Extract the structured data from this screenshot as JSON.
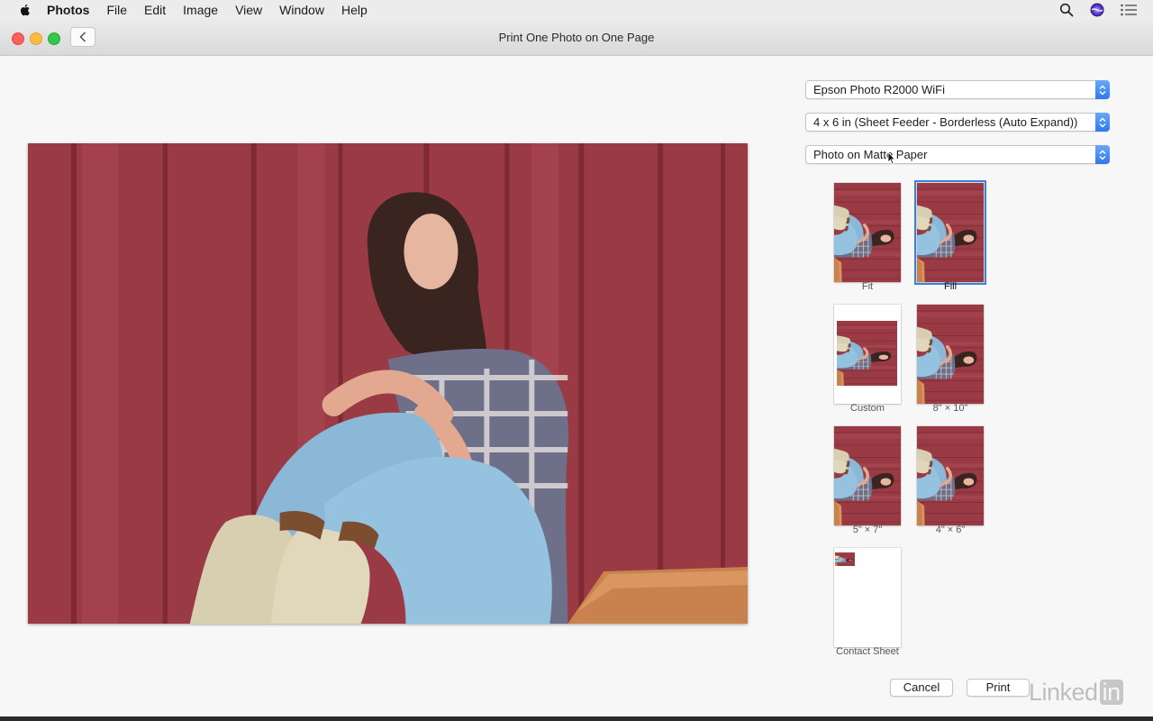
{
  "menubar": {
    "app_name": "Photos",
    "items": [
      "File",
      "Edit",
      "Image",
      "View",
      "Window",
      "Help"
    ],
    "icons": [
      "apple-icon",
      "spotlight-search-icon",
      "siri-icon",
      "notification-center-icon"
    ]
  },
  "window": {
    "title": "Print One Photo on One Page"
  },
  "print_options": {
    "printer": "Epson Photo R2000 WiFi",
    "paper_size": "4 x 6 in (Sheet Feeder - Borderless (Auto Expand))",
    "paper_type": "Photo on Matte Paper"
  },
  "layouts": [
    {
      "label": "Fit",
      "selected": false
    },
    {
      "label": "Fill",
      "selected": true
    },
    {
      "label": "Custom",
      "selected": false
    },
    {
      "label": "8\" × 10\"",
      "selected": false
    },
    {
      "label": "5\" × 7\"",
      "selected": false
    },
    {
      "label": "4\" × 6\"",
      "selected": false
    },
    {
      "label": "Contact Sheet",
      "selected": false
    }
  ],
  "buttons": {
    "cancel": "Cancel",
    "print": "Print"
  },
  "watermark": {
    "text": "Linked",
    "badge": "in"
  },
  "colors": {
    "accent": "#3b7fe0",
    "barn_red": "#9e3d47"
  }
}
